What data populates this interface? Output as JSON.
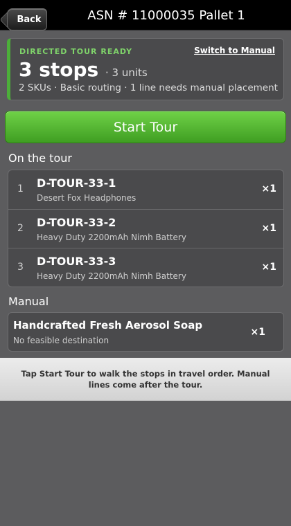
{
  "header": {
    "back_label": "Back",
    "title": "ASN # 11000035 Pallet 1"
  },
  "summary": {
    "status": "DIRECTED TOUR READY",
    "switch_label": "Switch to Manual",
    "stops": "3 stops",
    "units": "· 3 units",
    "meta": "2 SKUs · Basic routing · 1 line needs manual placement"
  },
  "start_button_label": "Start Tour",
  "tour": {
    "heading": "On the tour",
    "rows": [
      {
        "num": "1",
        "code": "D-TOUR-33-1",
        "desc": "Desert Fox Headphones",
        "qty": "×1"
      },
      {
        "num": "2",
        "code": "D-TOUR-33-2",
        "desc": "Heavy Duty 2200mAh Nimh Battery",
        "qty": "×1"
      },
      {
        "num": "3",
        "code": "D-TOUR-33-3",
        "desc": "Heavy Duty 2200mAh Nimh Battery",
        "qty": "×1"
      }
    ]
  },
  "manual": {
    "heading": "Manual",
    "rows": [
      {
        "name": "Handcrafted Fresh Aerosol Soap",
        "desc": "No feasible destination",
        "qty": "×1"
      }
    ]
  },
  "footer_text": "Tap Start Tour to walk the stops in travel order. Manual lines come after the tour.",
  "colors": {
    "accent_green": "#4caf3a",
    "status_green": "#7fd36a",
    "background": "#5c5c5e"
  }
}
